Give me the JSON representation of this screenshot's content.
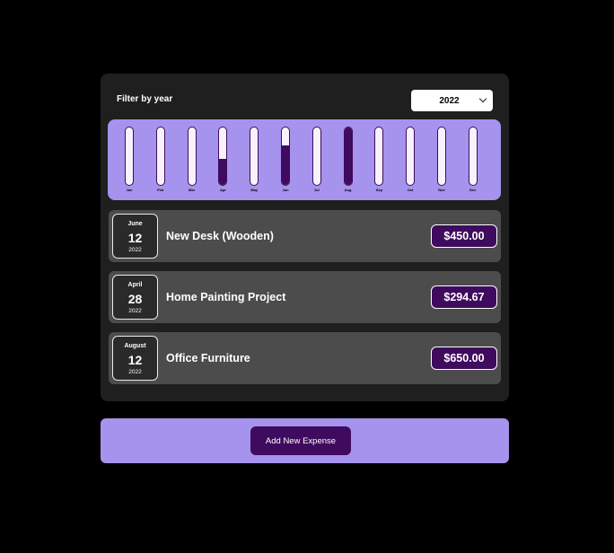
{
  "filter": {
    "label": "Filter by year",
    "selected_year": "2022"
  },
  "chart_data": {
    "type": "bar",
    "categories": [
      "Jan",
      "Feb",
      "Mar",
      "Apr",
      "May",
      "Jun",
      "Jul",
      "Aug",
      "Sep",
      "Oct",
      "Nov",
      "Dec"
    ],
    "values": [
      0,
      0,
      0,
      294.67,
      0,
      450.0,
      0,
      650.0,
      0,
      0,
      0,
      0
    ],
    "ylim": [
      0,
      650
    ],
    "fill_color": "#3f0b5e",
    "background_color": "#a593ed"
  },
  "expenses": [
    {
      "month": "June",
      "day": "12",
      "year": "2022",
      "title": "New Desk (Wooden)",
      "amount": "$450.00"
    },
    {
      "month": "April",
      "day": "28",
      "year": "2022",
      "title": "Home Painting Project",
      "amount": "$294.67"
    },
    {
      "month": "August",
      "day": "12",
      "year": "2022",
      "title": "Office Furniture",
      "amount": "$650.00"
    }
  ],
  "new_expense": {
    "button_label": "Add New Expense"
  },
  "colors": {
    "page_background": "#000000",
    "panel_background": "#1f1f1f",
    "item_background": "#4c4c4c",
    "accent_purple": "#3f0b5e",
    "lavender": "#a593ed"
  }
}
